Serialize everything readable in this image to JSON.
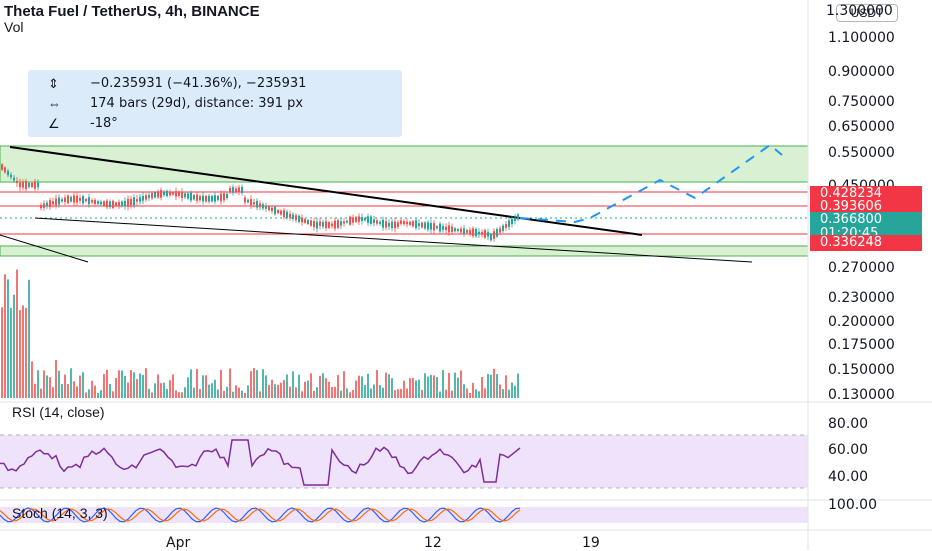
{
  "header": {
    "title": "Theta Fuel / TetherUS, 4h, BINANCE",
    "vol_label": "Vol"
  },
  "currency_button": "USDT",
  "measure_tool": {
    "row1": "−0.235931 (−41.36%), −235931",
    "row2": "174 bars (29d), distance: 391 px",
    "row3": "-18°"
  },
  "price_axis": {
    "labels": [
      "1.100000",
      "0.900000",
      "0.750000",
      "0.650000",
      "0.550000",
      "0.450000",
      "0.270000",
      "0.230000",
      "0.200000",
      "0.175000",
      "0.150000",
      "0.130000"
    ],
    "top_partial": "1.300000"
  },
  "price_tags": {
    "tag1": "0.428234",
    "tag2": "0.393606",
    "current": "0.366800",
    "countdown": "01:20:45",
    "tag3": "0.336248"
  },
  "rsi": {
    "title": "RSI (14, close)",
    "axis": [
      "80.00",
      "60.00",
      "40.00"
    ]
  },
  "stoch": {
    "title": "Stoch (14, 3, 3)",
    "axis": [
      "100.00"
    ]
  },
  "time_axis": [
    "Apr",
    "12",
    "19"
  ],
  "colors": {
    "up": "#26a69a",
    "down": "#ef5350",
    "zone_fill": "#d9f0d3",
    "zone_border": "#4caf50",
    "resistance": "#f23645",
    "current_tag": "#26a69a",
    "projection": "#2196f3",
    "rsi_line": "#7e2d9c",
    "rsi_band": "#efe3fb",
    "stoch_k": "#2962ff",
    "stoch_d": "#ff6d00"
  }
}
